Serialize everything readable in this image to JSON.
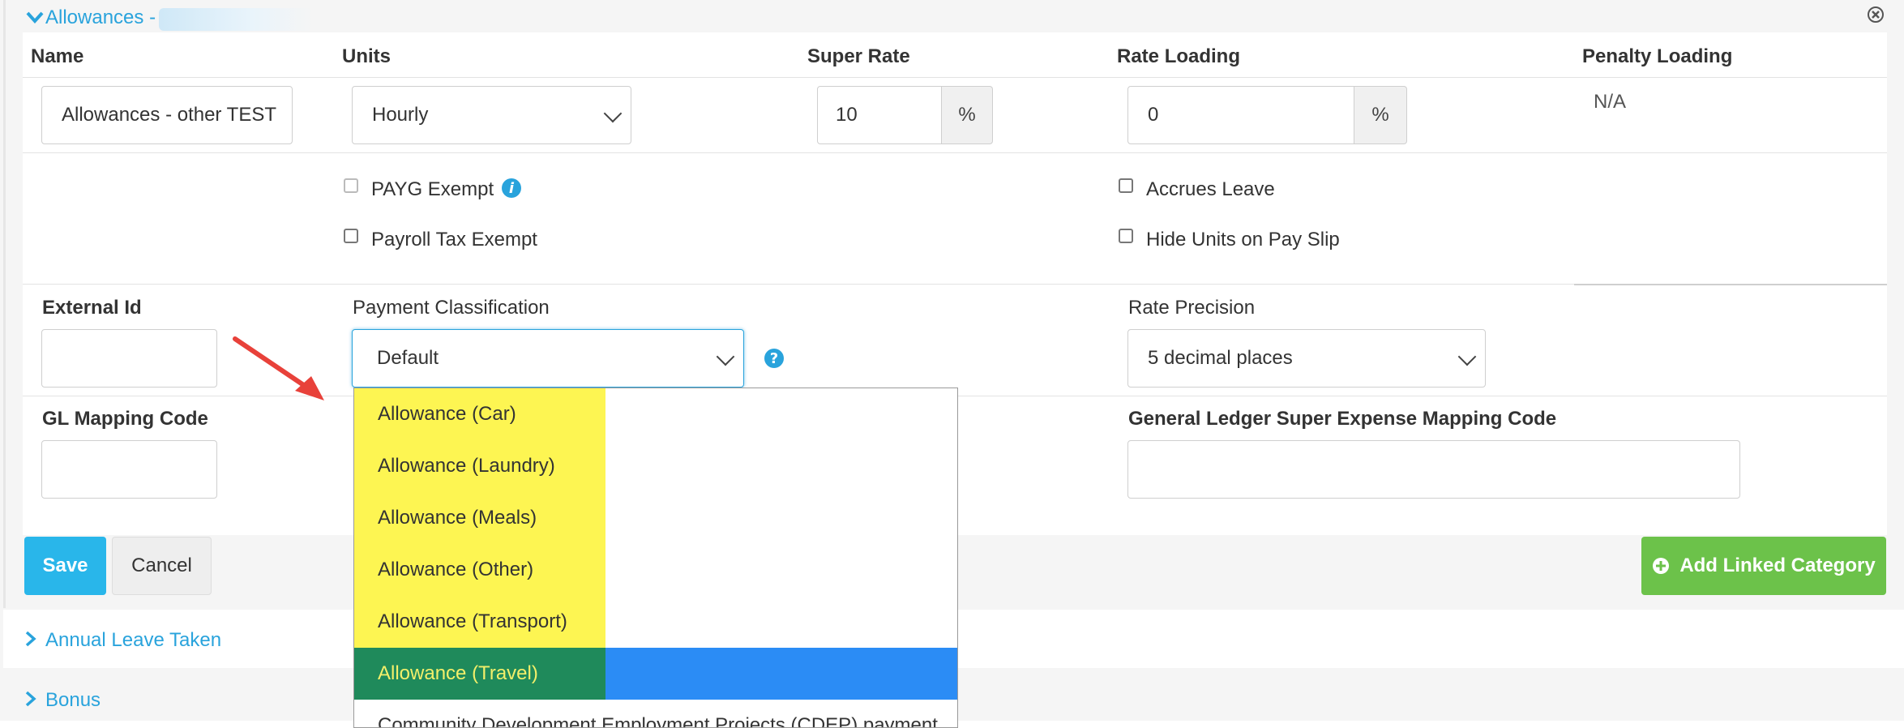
{
  "header": {
    "title": "Allowances -"
  },
  "columns": {
    "name": "Name",
    "units": "Units",
    "super_rate": "Super Rate",
    "rate_loading": "Rate Loading",
    "penalty_loading": "Penalty Loading"
  },
  "fields": {
    "name_value": "Allowances - other TEST",
    "units_value": "Hourly",
    "super_rate_value": "10",
    "super_rate_addon": "%",
    "rate_loading_value": "0",
    "rate_loading_addon": "%",
    "penalty_loading_value": "N/A"
  },
  "checkboxes": {
    "payg_exempt": "PAYG Exempt",
    "payroll_tax_exempt": "Payroll Tax Exempt",
    "accrues_leave": "Accrues Leave",
    "hide_units": "Hide Units on Pay Slip"
  },
  "labels": {
    "external_id": "External Id",
    "payment_classification": "Payment Classification",
    "rate_precision": "Rate Precision",
    "gl_mapping_code": "GL Mapping Code",
    "gl_super_expense": "General Ledger Super Expense Mapping Code"
  },
  "selects": {
    "payment_classification_value": "Default",
    "rate_precision_value": "5 decimal places"
  },
  "dropdown": {
    "items": [
      "Allowance (Car)",
      "Allowance (Laundry)",
      "Allowance (Meals)",
      "Allowance (Other)",
      "Allowance (Transport)",
      "Allowance (Travel)",
      "Community Development Employment Projects (CDEP) payment"
    ],
    "selected_index": 5
  },
  "buttons": {
    "save": "Save",
    "cancel": "Cancel",
    "add_linked": "Add Linked Category"
  },
  "sections": {
    "annual_leave": "Annual Leave Taken",
    "bonus": "Bonus"
  },
  "colors": {
    "accent": "#29a3dc",
    "save": "#29b6ea",
    "add": "#6cc24a",
    "highlight": "#fdf552",
    "selected": "#2b8cf5",
    "arrow": "#e8413a"
  }
}
